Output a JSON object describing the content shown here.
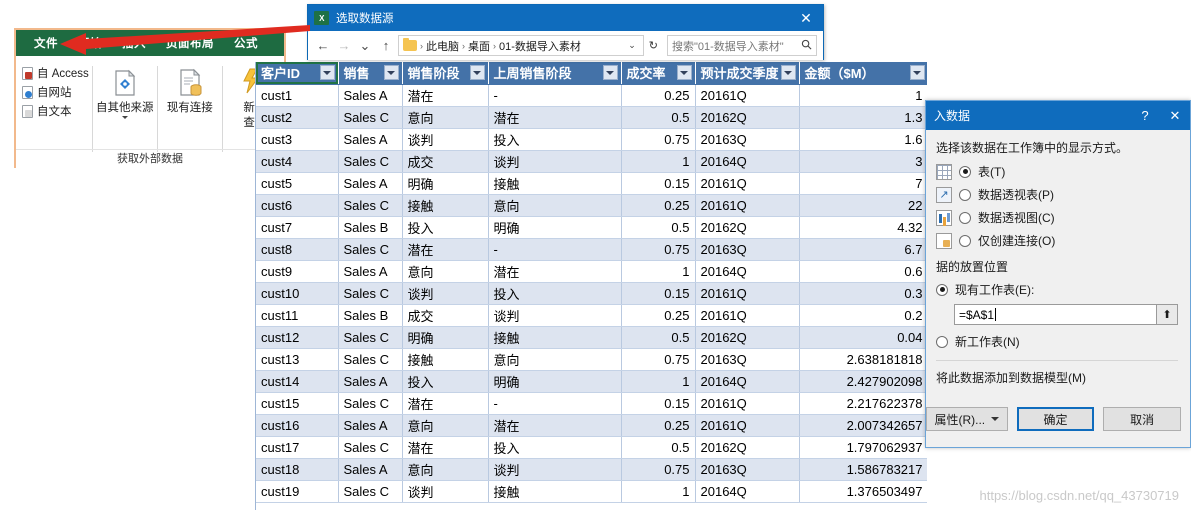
{
  "excel_ribbon": {
    "tabs": [
      {
        "label": "文件"
      },
      {
        "label": "开始"
      },
      {
        "label": "插入"
      },
      {
        "label": "页面布局"
      },
      {
        "label": "公式"
      }
    ],
    "small_buttons": [
      {
        "label": "自 Access",
        "icon": "access-file-icon"
      },
      {
        "label": "自网站",
        "icon": "web-file-icon"
      },
      {
        "label": "自文本",
        "icon": "text-file-icon"
      }
    ],
    "big_buttons": [
      {
        "label": "自其他来源",
        "icon": "other-sources-icon"
      },
      {
        "label": "现有连接",
        "icon": "existing-connections-icon"
      },
      {
        "label": "新建\n查询",
        "icon": "new-query-icon"
      }
    ],
    "big_button_1": "自其他来源",
    "big_button_2": "现有连接",
    "big_button_3_line1": "新建",
    "big_button_3_line2": "查询",
    "group_caption": "获取外部数据"
  },
  "file_dialog": {
    "title": "选取数据源",
    "close_label": "✕",
    "nav": {
      "back": "←",
      "forward": "→",
      "recent": "⌄",
      "up": "↑",
      "crumbs": [
        "此电脑",
        "桌面",
        "01-数据导入素材"
      ],
      "crumb_sep": "›",
      "dropdown": "⌄",
      "refresh": "↻"
    },
    "search_placeholder": "搜索\"01-数据导入素材\"",
    "search_icon": "🔍"
  },
  "data_table": {
    "headers": [
      "客户ID",
      "销售",
      "销售阶段",
      "上周销售阶段",
      "成交率",
      "预计成交季度",
      "金额（$M）"
    ],
    "rows": [
      [
        "cust1",
        "Sales A",
        "潜在",
        "-",
        "0.25",
        "20161Q",
        "1"
      ],
      [
        "cust2",
        "Sales C",
        "意向",
        "潜在",
        "0.5",
        "20162Q",
        "1.3"
      ],
      [
        "cust3",
        "Sales A",
        "谈判",
        "投入",
        "0.75",
        "20163Q",
        "1.6"
      ],
      [
        "cust4",
        "Sales C",
        "成交",
        "谈判",
        "1",
        "20164Q",
        "3"
      ],
      [
        "cust5",
        "Sales A",
        "明确",
        "接触",
        "0.15",
        "20161Q",
        "7"
      ],
      [
        "cust6",
        "Sales C",
        "接触",
        "意向",
        "0.25",
        "20161Q",
        "22"
      ],
      [
        "cust7",
        "Sales B",
        "投入",
        "明确",
        "0.5",
        "20162Q",
        "4.32"
      ],
      [
        "cust8",
        "Sales C",
        "潜在",
        "-",
        "0.75",
        "20163Q",
        "6.7"
      ],
      [
        "cust9",
        "Sales A",
        "意向",
        "潜在",
        "1",
        "20164Q",
        "0.6"
      ],
      [
        "cust10",
        "Sales C",
        "谈判",
        "投入",
        "0.15",
        "20161Q",
        "0.3"
      ],
      [
        "cust11",
        "Sales B",
        "成交",
        "谈判",
        "0.25",
        "20161Q",
        "0.2"
      ],
      [
        "cust12",
        "Sales C",
        "明确",
        "接触",
        "0.5",
        "20162Q",
        "0.04"
      ],
      [
        "cust13",
        "Sales C",
        "接触",
        "意向",
        "0.75",
        "20163Q",
        "2.638181818"
      ],
      [
        "cust14",
        "Sales A",
        "投入",
        "明确",
        "1",
        "20164Q",
        "2.427902098"
      ],
      [
        "cust15",
        "Sales C",
        "潜在",
        "-",
        "0.15",
        "20161Q",
        "2.217622378"
      ],
      [
        "cust16",
        "Sales A",
        "意向",
        "潜在",
        "0.25",
        "20161Q",
        "2.007342657"
      ],
      [
        "cust17",
        "Sales C",
        "潜在",
        "投入",
        "0.5",
        "20162Q",
        "1.797062937"
      ],
      [
        "cust18",
        "Sales A",
        "意向",
        "谈判",
        "0.75",
        "20163Q",
        "1.586783217"
      ],
      [
        "cust19",
        "Sales C",
        "谈判",
        "接触",
        "1",
        "20164Q",
        "1.376503497"
      ]
    ]
  },
  "import_dialog": {
    "title": "入数据",
    "help_label": "?",
    "close_label": "✕",
    "prompt": "选择该数据在工作簿中的显示方式。",
    "display_options": [
      {
        "label": "表(T)",
        "selected": true,
        "icon": "table-icon"
      },
      {
        "label": "数据透视表(P)",
        "selected": false,
        "icon": "pivot-table-icon"
      },
      {
        "label": "数据透视图(C)",
        "selected": false,
        "icon": "pivot-chart-icon"
      },
      {
        "label": "仅创建连接(O)",
        "selected": false,
        "icon": "connection-only-icon"
      }
    ],
    "location_title": "据的放置位置",
    "location_options": [
      {
        "label": "现有工作表(E):",
        "selected": true
      },
      {
        "label": "新工作表(N)",
        "selected": false
      }
    ],
    "range_value": "=$A$1",
    "range_picker_icon": "⬆",
    "data_model_label": "将此数据添加到数据模型(M)",
    "buttons": {
      "properties": "属性(R)...",
      "ok": "确定",
      "cancel": "取消"
    }
  },
  "watermark": "https://blog.csdn.net/qq_43730719",
  "colors": {
    "excel_green": "#1e6b41",
    "dialog_blue": "#0f6cbd",
    "header_blue": "#4472a8",
    "row_alt": "#dde4f0",
    "arrow_red": "#e02b20"
  }
}
